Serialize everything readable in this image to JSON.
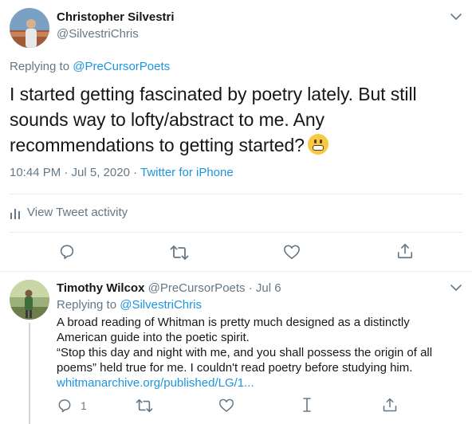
{
  "tweet": {
    "author_name": "Christopher Silvestri",
    "author_handle": "@SilvestriChris",
    "replying_prefix": "Replying to ",
    "replying_handle": "@PreCursorPoets",
    "text": "I started getting fascinated by poetry lately. But still sounds way to lofty/abstract to me. Any recommendations to getting started?",
    "time": "10:44 PM · Jul 5, 2020 · ",
    "source": "Twitter for iPhone",
    "activity_label": "View Tweet activity"
  },
  "reply": {
    "author_name": "Timothy Wilcox",
    "author_handle": "@PreCursorPoets",
    "date": "· Jul 6",
    "replying_prefix": "Replying to ",
    "replying_handle": "@SilvestriChris",
    "line1": "A broad reading of Whitman is pretty much designed as a distinctly",
    "line2": "American guide into the poetic spirit.",
    "line3": "“Stop this day and night with me, and you shall possess the origin of all",
    "line4": "poems” held true for me. I couldn't read poetry before studying him.",
    "link": "whitmanarchive.org/published/LG/1...",
    "reply_count": "1"
  },
  "icons": {
    "chevron": "chevron-down-icon",
    "reply": "reply-icon",
    "retweet": "retweet-icon",
    "like": "heart-icon",
    "share": "share-icon",
    "activity": "activity-icon",
    "analytics": "analytics-icon"
  },
  "colors": {
    "accent": "#1b95e0",
    "secondary_text": "#657786",
    "divider": "#e6ecf0"
  }
}
